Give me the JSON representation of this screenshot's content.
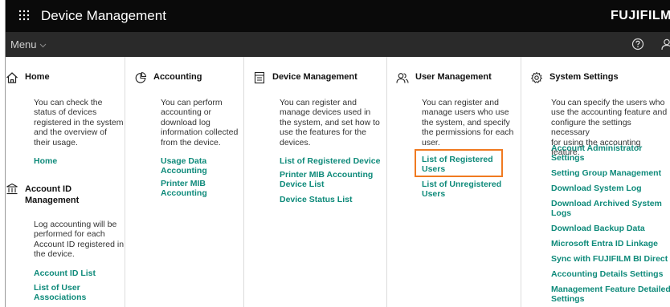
{
  "header": {
    "title": "Device Management",
    "brand": "FUJIFILM"
  },
  "menubar": {
    "menu_label": "Menu"
  },
  "columns": {
    "home": {
      "title": "Home",
      "description": [
        "You can check the",
        "status of devices",
        "registered in the system",
        "and the overview of",
        "their usage."
      ],
      "links": [
        "Home"
      ]
    },
    "account_id": {
      "title": [
        "Account ID",
        "Management"
      ],
      "description": [
        "Log accounting will be",
        "performed for each",
        "Account ID registered in",
        "the device."
      ],
      "links": [
        "Account ID List",
        "List of User",
        "Associations"
      ]
    },
    "accounting": {
      "title": "Accounting",
      "description": [
        "You can perform",
        "accounting or",
        "download log",
        "information collected",
        "from the device."
      ],
      "links": [
        "Usage Data",
        "Accounting",
        "Printer MIB",
        "Accounting"
      ]
    },
    "device_management": {
      "title": "Device Management",
      "description": [
        "You can register and",
        "manage devices used in",
        "the system, and set how to",
        "use the features for the",
        "devices."
      ],
      "links": [
        "List of Registered Device",
        "Printer MIB Accounting",
        "Device List",
        "Device Status List"
      ]
    },
    "user_management": {
      "title": "User Management",
      "description": [
        "You can register and",
        "manage users who use",
        "the system, and specify",
        "the permissions for each",
        "user."
      ],
      "links": [
        "List of Registered",
        "Users",
        "List of Unregistered",
        "Users"
      ]
    },
    "system_settings": {
      "title": "System Settings",
      "description": [
        "You can specify the users who",
        "use the accounting feature and",
        "configure the settings necessary",
        "for using the accounting feature."
      ],
      "links": [
        "Account Administrator",
        "Settings",
        "Setting Group Management",
        "Download System Log",
        "Download Archived System",
        "Logs",
        "Download Backup Data",
        "Microsoft Entra ID Linkage",
        "Sync with FUJIFILM BI Direct",
        "Accounting Details Settings",
        "Management Feature Detailed",
        "Settings"
      ]
    }
  },
  "colors": {
    "header_bg": "#0a0a0a",
    "menubar_bg": "#2a2a2a",
    "link": "#0e8a7a",
    "highlight": "#f07a20"
  }
}
